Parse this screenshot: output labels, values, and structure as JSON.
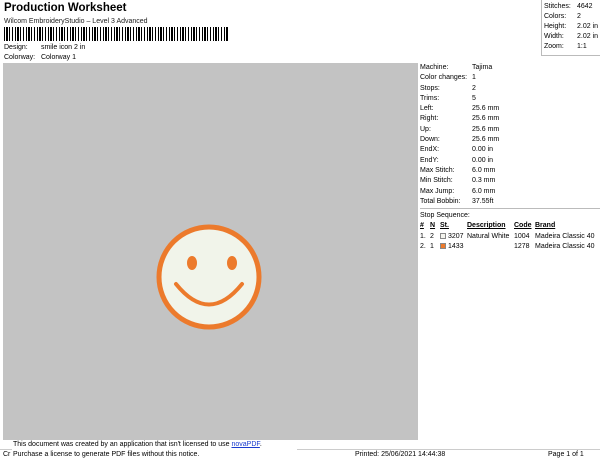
{
  "header": {
    "title": "Production Worksheet",
    "subtitle": "Wilcom EmbroideryStudio – Level 3 Advanced",
    "design_label": "Design:",
    "design_value": "smile icon 2 in",
    "colorway_label": "Colorway:",
    "colorway_value": "Colorway 1"
  },
  "stats": [
    {
      "label": "Stitches:",
      "value": "4642"
    },
    {
      "label": "Colors:",
      "value": "2"
    },
    {
      "label": "Height:",
      "value": "2.02 in"
    },
    {
      "label": "Width:",
      "value": "2.02 in"
    },
    {
      "label": "Zoom:",
      "value": "1:1"
    }
  ],
  "machine_info": [
    {
      "label": "Machine:",
      "value": "Tajima"
    },
    {
      "label": "Color changes:",
      "value": "1"
    },
    {
      "label": "Stops:",
      "value": "2"
    },
    {
      "label": "Trims:",
      "value": "5"
    },
    {
      "label": "Left:",
      "value": "25.6 mm"
    },
    {
      "label": "Right:",
      "value": "25.6 mm"
    },
    {
      "label": "Up:",
      "value": "25.6 mm"
    },
    {
      "label": "Down:",
      "value": "25.6 mm"
    },
    {
      "label": "EndX:",
      "value": "0.00 in"
    },
    {
      "label": "EndY:",
      "value": "0.00 in"
    },
    {
      "label": "Max Stitch:",
      "value": "6.0 mm"
    },
    {
      "label": "Min Stitch:",
      "value": "0.3 mm"
    },
    {
      "label": "Max Jump:",
      "value": "6.0 mm"
    },
    {
      "label": "Total Bobbin:",
      "value": "37.55ft"
    }
  ],
  "stop_sequence": {
    "title": "Stop Sequence:",
    "headers": {
      "num": "#",
      "n": "N",
      "st": "St.",
      "desc": "Description",
      "code": "Code",
      "brand": "Brand"
    },
    "rows": [
      {
        "num": "1.",
        "n": "2",
        "st": "3207",
        "desc": "Natural White",
        "code": "1004",
        "brand": "Madeira Classic 40",
        "color": "#f4f4ee"
      },
      {
        "num": "2.",
        "n": "1",
        "st": "1433",
        "desc": "",
        "code": "1278",
        "brand": "Madeira Classic 40",
        "color": "#ec7a2c"
      }
    ]
  },
  "design_colors": {
    "face_fill": "#f1f4ea",
    "outline": "#ec7a2c",
    "background": "#c3c3c3"
  },
  "notice": {
    "line1": "This document was created by an application that isn't licensed to use ",
    "link": "novaPDF",
    "line1_end": ".",
    "line2": "Purchase a license to generate PDF files without this notice."
  },
  "footer": {
    "left": "Cr",
    "printed": "Printed: 25/06/2021 14:44:38",
    "page": "Page 1 of 1"
  }
}
